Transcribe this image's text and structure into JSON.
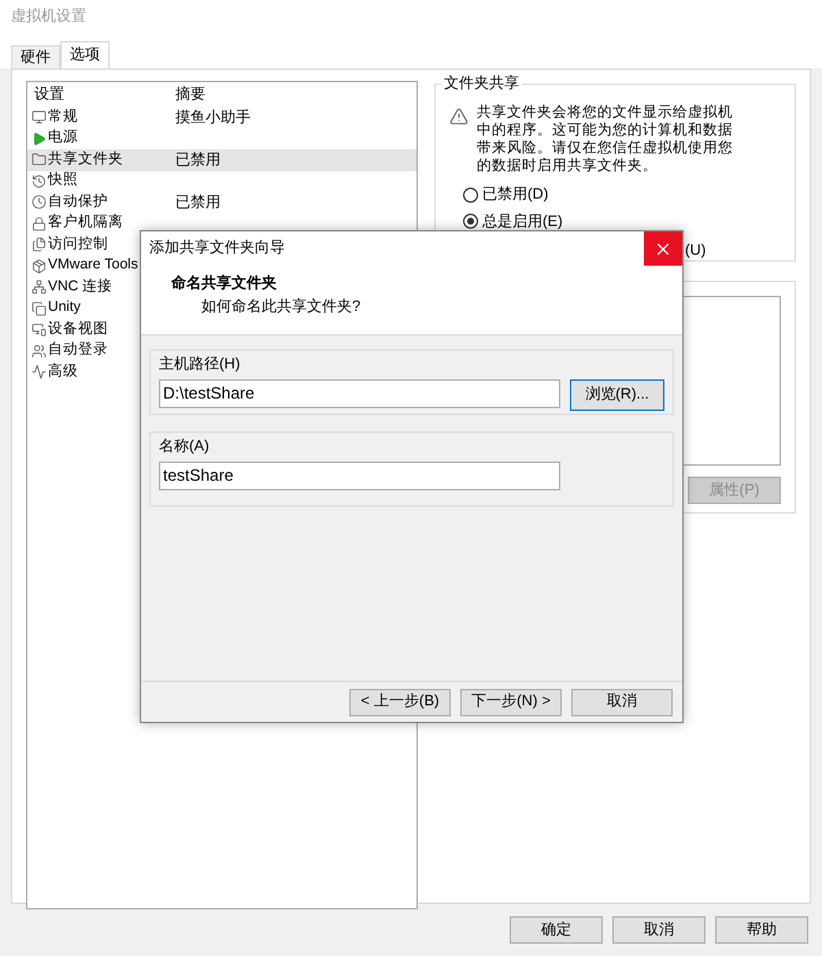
{
  "window": {
    "title": "虚拟机设置"
  },
  "tabs": [
    {
      "label": "硬件",
      "selected": false
    },
    {
      "label": "选项",
      "selected": true
    }
  ],
  "settings_list": {
    "columns": [
      "设置",
      "摘要"
    ],
    "rows": [
      {
        "name": "常规",
        "summary": "摸鱼小助手",
        "selected": false
      },
      {
        "name": "电源",
        "selected": false
      },
      {
        "name": "共享文件夹",
        "summary": "已禁用",
        "selected": true
      },
      {
        "name": "快照",
        "selected": false
      },
      {
        "name": "自动保护",
        "summary": "已禁用",
        "selected": false
      },
      {
        "name": "客户机隔离",
        "selected": false
      },
      {
        "name": "访问控制",
        "selected": false
      },
      {
        "name": "VMware Tools",
        "selected": false
      },
      {
        "name": "VNC 连接",
        "selected": false
      },
      {
        "name": "Unity",
        "selected": false
      },
      {
        "name": "设备视图",
        "selected": false
      },
      {
        "name": "自动登录",
        "selected": false
      },
      {
        "name": "高级",
        "selected": false
      }
    ]
  },
  "folder_sharing": {
    "title": "文件夹共享",
    "warning": "共享文件夹会将您的文件显示给虚拟机中的程序。这可能为您的计算机和数据带来风险。请仅在您信任虚拟机使用您的数据时启用共享文件夹。",
    "options": [
      {
        "label": "已禁用(D)",
        "selected": false
      },
      {
        "label": "总是启用(E)",
        "selected": true
      }
    ],
    "partial_option_text": "(U)"
  },
  "properties_button": {
    "label": "属性(P)",
    "disabled": true
  },
  "dialog": {
    "title": "添加共享文件夹向导",
    "heading": "命名共享文件夹",
    "subheading": "如何命名此共享文件夹?",
    "host_path": {
      "label": "主机路径(H)",
      "value": "D:\\testShare",
      "browse_button": "浏览(R)..."
    },
    "name": {
      "label": "名称(A)",
      "value": "testShare"
    },
    "buttons": [
      "< 上一步(B)",
      "下一步(N) >",
      "取消"
    ]
  },
  "buttons": [
    "确定",
    "取消",
    "帮助"
  ]
}
